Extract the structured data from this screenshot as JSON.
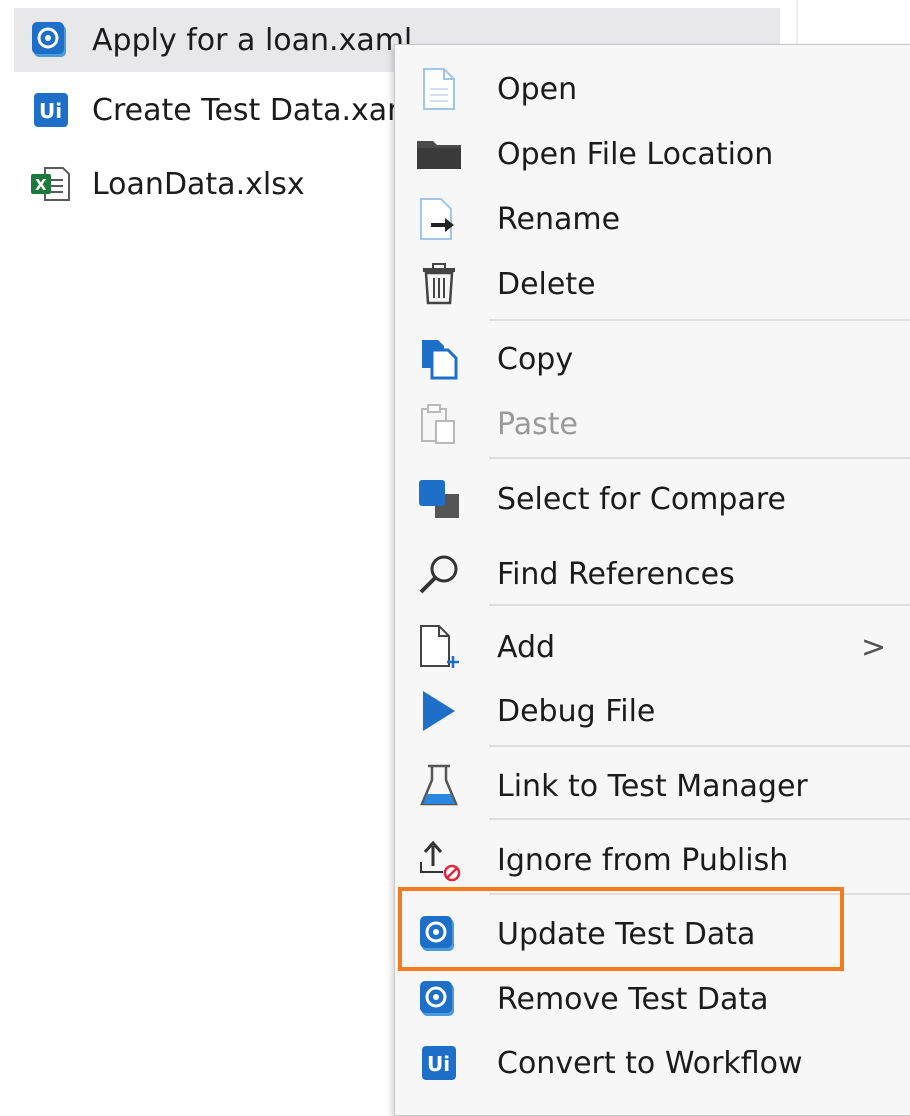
{
  "tree": {
    "items": [
      {
        "label": "Apply for a loan.xaml",
        "icon": "test-case-icon",
        "selected": true
      },
      {
        "label": "Create Test Data.xaml",
        "icon": "uipath-workflow-icon"
      },
      {
        "label": "LoanData.xlsx",
        "icon": "excel-file-icon"
      }
    ]
  },
  "menu": {
    "items": [
      {
        "label": "Open",
        "icon": "document-icon"
      },
      {
        "label": "Open File Location",
        "icon": "folder-icon"
      },
      {
        "label": "Rename",
        "icon": "rename-icon"
      },
      {
        "label": "Delete",
        "icon": "trash-icon"
      },
      {
        "label": "Copy",
        "icon": "copy-icon"
      },
      {
        "label": "Paste",
        "icon": "paste-icon",
        "disabled": true
      },
      {
        "label": "Select for Compare",
        "icon": "compare-icon"
      },
      {
        "label": "Find References",
        "icon": "search-icon"
      },
      {
        "label": "Add",
        "icon": "add-file-icon",
        "submenu": ">"
      },
      {
        "label": "Debug File",
        "icon": "play-icon"
      },
      {
        "label": "Link to Test Manager",
        "icon": "flask-icon"
      },
      {
        "label": "Ignore from Publish",
        "icon": "upload-blocked-icon"
      },
      {
        "label": "Update Test Data",
        "icon": "test-case-icon",
        "highlighted": true
      },
      {
        "label": "Remove Test Data",
        "icon": "test-case-icon"
      },
      {
        "label": "Convert to Workflow",
        "icon": "uipath-workflow-icon"
      }
    ],
    "highlight_color": "#F47B20",
    "accent_color": "#1A73E8"
  }
}
